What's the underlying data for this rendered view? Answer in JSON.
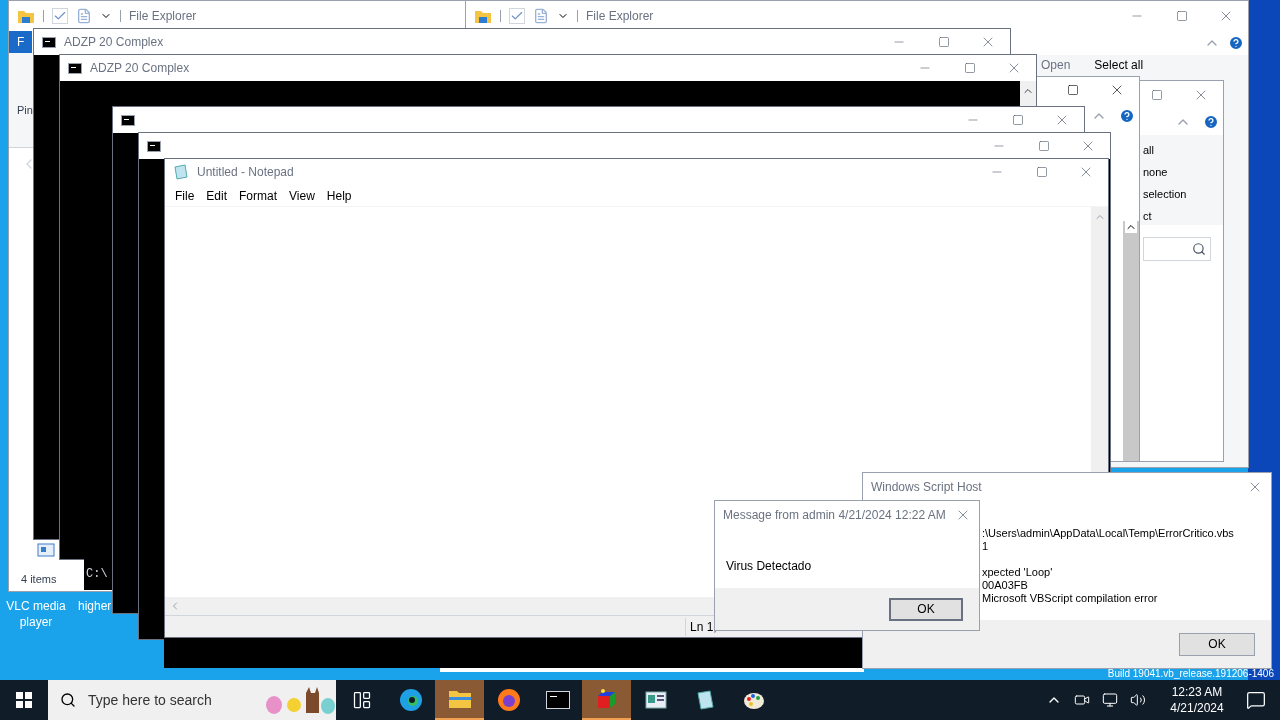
{
  "desktop": {
    "icons": [
      {
        "label": "VLC media player"
      },
      {
        "label": "higher"
      }
    ]
  },
  "explorer_windows": [
    {
      "title": "File Explorer",
      "ribbon_tab": "F",
      "pinned_label": "Pin",
      "status": "4 items"
    },
    {
      "title": "File Explorer",
      "ribbon_buttons": [
        "Open",
        "Select all"
      ]
    },
    {
      "ribbon_items": [
        "all",
        "none",
        "selection",
        "ct"
      ]
    }
  ],
  "consoles": [
    {
      "kind": "titled",
      "title": "ADZP 20 Complex"
    },
    {
      "kind": "titled",
      "title": "ADZP 20 Complex",
      "line": "C:\\"
    },
    {
      "kind": "untitled"
    },
    {
      "kind": "untitled"
    }
  ],
  "notepad": {
    "title": "Untitled - Notepad",
    "menu": [
      "File",
      "Edit",
      "Format",
      "View",
      "Help"
    ],
    "status": "Ln 1,"
  },
  "script_host": {
    "title": "Windows Script Host",
    "file_lines": [
      ":\\Users\\admin\\AppData\\Local\\Temp\\ErrorCritico.vbs",
      "1"
    ],
    "error_lines": [
      "xpected 'Loop'",
      "00A03FB",
      "Microsoft VBScript compilation error"
    ],
    "button": "OK"
  },
  "message_box": {
    "title": "Message from admin 4/21/2024 12:22 AM",
    "text": "Virus Detectado",
    "button": "OK"
  },
  "build_text": "Build 19041.vb_release.191206-1406",
  "taskbar": {
    "search": {
      "placeholder": "Type here to search"
    },
    "apps": [
      {
        "kind": "task-view",
        "active": false
      },
      {
        "kind": "edge",
        "active": false
      },
      {
        "kind": "explorer",
        "active": true
      },
      {
        "kind": "firefox",
        "active": false
      },
      {
        "kind": "console",
        "active": false
      },
      {
        "kind": "cube",
        "active": true
      },
      {
        "kind": "panel",
        "active": false
      },
      {
        "kind": "notepad",
        "active": false
      },
      {
        "kind": "paint",
        "active": false
      }
    ],
    "clock": {
      "time": "12:23 AM",
      "date": "4/21/2024"
    }
  }
}
